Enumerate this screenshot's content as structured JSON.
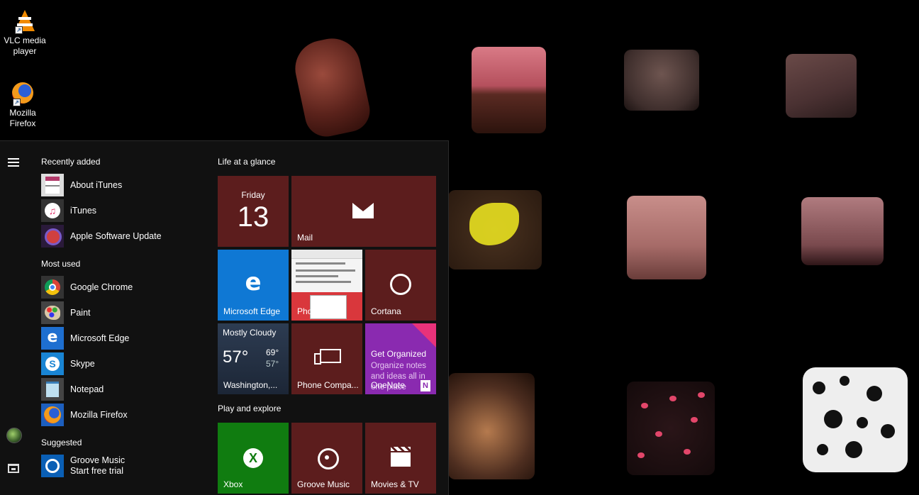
{
  "desktop": {
    "icons": [
      {
        "label": "VLC media player",
        "icon": "vlc-cone-icon"
      },
      {
        "label": "Mozilla Firefox",
        "icon": "firefox-icon"
      }
    ]
  },
  "start_menu": {
    "sections": {
      "recently_added": "Recently added",
      "most_used": "Most used",
      "suggested": "Suggested"
    },
    "recently_added": [
      {
        "label": "About iTunes",
        "icon": "about-itunes-icon"
      },
      {
        "label": "iTunes",
        "icon": "itunes-icon"
      },
      {
        "label": "Apple Software Update",
        "icon": "apple-software-update-icon"
      }
    ],
    "most_used": [
      {
        "label": "Google Chrome",
        "icon": "chrome-icon"
      },
      {
        "label": "Paint",
        "icon": "paint-icon"
      },
      {
        "label": "Microsoft Edge",
        "icon": "edge-icon"
      },
      {
        "label": "Skype",
        "icon": "skype-icon"
      },
      {
        "label": "Notepad",
        "icon": "notepad-icon"
      },
      {
        "label": "Mozilla Firefox",
        "icon": "firefox-icon"
      }
    ],
    "suggested": [
      {
        "label": "Groove Music",
        "sublabel": "Start free trial",
        "icon": "groove-music-icon"
      }
    ]
  },
  "tiles": {
    "groups": {
      "life": "Life at a glance",
      "play": "Play and explore"
    },
    "calendar": {
      "day": "Friday",
      "date": "13"
    },
    "mail": {
      "label": "Mail"
    },
    "edge": {
      "label": "Microsoft Edge"
    },
    "photos": {
      "label": "Photos"
    },
    "cortana": {
      "label": "Cortana"
    },
    "weather": {
      "condition": "Mostly Cloudy",
      "temp": "57°",
      "high": "69°",
      "low": "57°",
      "location": "Washington,..."
    },
    "phone": {
      "label": "Phone Compa..."
    },
    "onenote": {
      "heading": "Get Organized",
      "body": "Organize notes and ideas all in one place",
      "label": "OneNote"
    },
    "xbox": {
      "label": "Xbox"
    },
    "groove": {
      "label": "Groove Music"
    },
    "movies": {
      "label": "Movies & TV"
    }
  },
  "colors": {
    "tile_accent": "#5c1d1d",
    "edge_blue": "#0f78d4",
    "xbox_green": "#107c10",
    "onenote_purple": "#8a2ab0"
  }
}
